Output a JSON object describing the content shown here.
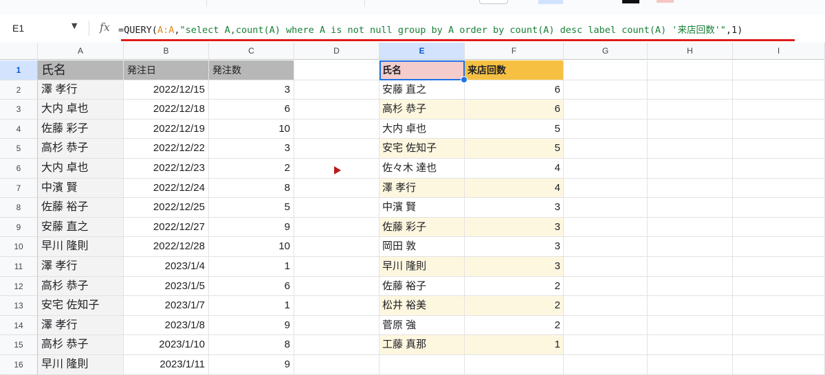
{
  "namebox": {
    "ref": "E1"
  },
  "formula": {
    "fx_label": "fx",
    "p1": "=QUERY(",
    "ref": "A:A",
    "p2": ",",
    "str": "\"select A,count(A) where A is not null group by A order by count(A) desc label count(A) '来店回数'\"",
    "p3": ",1)"
  },
  "columns": [
    "A",
    "B",
    "C",
    "D",
    "E",
    "F",
    "G",
    "H",
    "I"
  ],
  "selected_column": "E",
  "selected_row": "1",
  "rows": [
    "1",
    "2",
    "3",
    "4",
    "5",
    "6",
    "7",
    "8",
    "9",
    "10",
    "11",
    "12",
    "13",
    "14",
    "15",
    "16"
  ],
  "left_table": {
    "headers": {
      "name": "氏名",
      "date": "発注日",
      "qty": "発注数"
    },
    "data": [
      {
        "name": "澤 孝行",
        "date": "2022/12/15",
        "qty": "3"
      },
      {
        "name": "大内 卓也",
        "date": "2022/12/18",
        "qty": "6"
      },
      {
        "name": "佐藤 彩子",
        "date": "2022/12/19",
        "qty": "10"
      },
      {
        "name": "高杉 恭子",
        "date": "2022/12/22",
        "qty": "3"
      },
      {
        "name": "大内 卓也",
        "date": "2022/12/23",
        "qty": "2"
      },
      {
        "name": "中濱 賢",
        "date": "2022/12/24",
        "qty": "8"
      },
      {
        "name": "佐藤 裕子",
        "date": "2022/12/25",
        "qty": "5"
      },
      {
        "name": "安藤 直之",
        "date": "2022/12/27",
        "qty": "9"
      },
      {
        "name": "早川 隆則",
        "date": "2022/12/28",
        "qty": "10"
      },
      {
        "name": "澤 孝行",
        "date": "2023/1/4",
        "qty": "1"
      },
      {
        "name": "高杉 恭子",
        "date": "2023/1/5",
        "qty": "6"
      },
      {
        "name": "安宅 佐知子",
        "date": "2023/1/7",
        "qty": "1"
      },
      {
        "name": "澤 孝行",
        "date": "2023/1/8",
        "qty": "9"
      },
      {
        "name": "高杉 恭子",
        "date": "2023/1/10",
        "qty": "8"
      },
      {
        "name": "早川 隆則",
        "date": "2023/1/11",
        "qty": "9"
      }
    ]
  },
  "result_table": {
    "headers": {
      "name": "氏名",
      "count": "来店回数"
    },
    "data": [
      {
        "name": "安藤 直之",
        "count": "6"
      },
      {
        "name": "高杉 恭子",
        "count": "6"
      },
      {
        "name": "大内 卓也",
        "count": "5"
      },
      {
        "name": "安宅 佐知子",
        "count": "5"
      },
      {
        "name": "佐々木 達也",
        "count": "4"
      },
      {
        "name": "澤 孝行",
        "count": "4"
      },
      {
        "name": "中濱 賢",
        "count": "3"
      },
      {
        "name": "佐藤 彩子",
        "count": "3"
      },
      {
        "name": "岡田 敦",
        "count": "3"
      },
      {
        "name": "早川 隆則",
        "count": "3"
      },
      {
        "name": "佐藤 裕子",
        "count": "2"
      },
      {
        "name": "松井 裕美",
        "count": "2"
      },
      {
        "name": "菅原 強",
        "count": "2"
      },
      {
        "name": "工藤 真那",
        "count": "1"
      }
    ]
  },
  "colors": {
    "header_gray": "#b7b7b7",
    "name_header_pink": "#f4cccc",
    "count_header_gold": "#f6c143",
    "band_cream": "#fef7e0",
    "selection_blue": "#1a73e8",
    "underline_red": "#e01b1b",
    "marker_red": "#b71c1c"
  }
}
